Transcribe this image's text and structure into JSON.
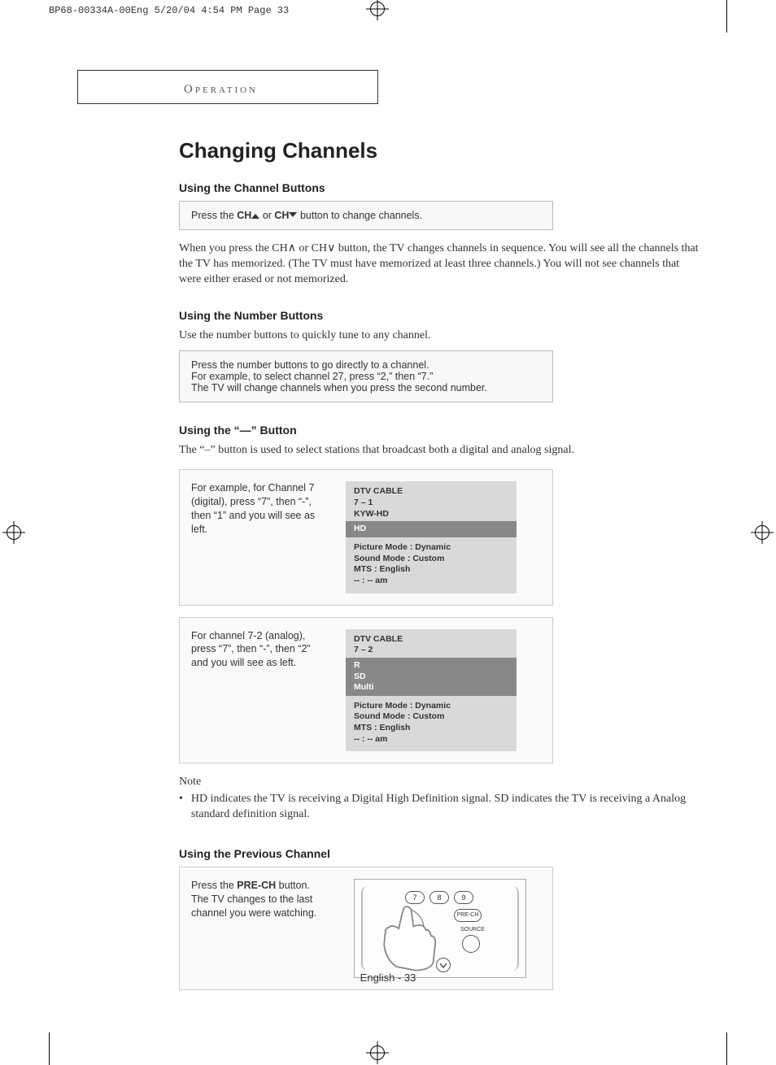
{
  "cropmark": "BP68-00334A-00Eng  5/20/04  4:54 PM  Page 33",
  "section_header": "Operation",
  "title": "Changing Channels",
  "s1": {
    "heading": "Using the Channel Buttons",
    "box_pre": "Press the ",
    "box_ch": "CH",
    "box_mid": "  or ",
    "box_post": " button to change channels.",
    "body": "When you press the CH∧  or CH∨ button, the TV changes channels in sequence. You will see all the channels that the TV has memorized. (The TV must have memorized at least three channels.) You will not see channels that were either erased or not memorized."
  },
  "s2": {
    "heading": "Using the Number Buttons",
    "lead": "Use the number buttons to quickly tune to any channel.",
    "box_l1": "Press the number buttons to go directly to a channel.",
    "box_l2": "For example, to select channel 27, press “2,” then “7.”",
    "box_l3": "The TV will change channels when you press the second number."
  },
  "s3": {
    "heading": "Using the “—” Button",
    "lead": "The “–” button is used to select stations that broadcast both a digital and analog signal.",
    "ex1_text": "For example, for Channel 7 (digital), press “7”, then “-”, then “1” and you will see as left.",
    "ex1_osd": {
      "l1": "DTV CABLE",
      "l2": "7 – 1",
      "l3": "KYW-HD",
      "band": "HD",
      "b1": "Picture Mode : Dynamic",
      "b2": "Sound Mode : Custom",
      "b3": "MTS : English",
      "b4": "-- : -- am"
    },
    "ex2_text": "For channel 7-2 (analog), press “7”, then “-”, then “2” and you will see as left.",
    "ex2_osd": {
      "l1": "DTV CABLE",
      "l2": "7 – 2",
      "band1": "R",
      "band2": "SD",
      "band3": "Multi",
      "b1": "Picture Mode : Dynamic",
      "b2": "Sound Mode : Custom",
      "b3": "MTS : English",
      "b4": "-- : -- am"
    }
  },
  "note": {
    "title": "Note",
    "bullet": "•",
    "text": "HD indicates the TV is receiving a Digital High Definition signal. SD indicates the TV is receiving a Analog standard definition signal."
  },
  "s4": {
    "heading": "Using the Previous Channel",
    "box_pre": "Press the ",
    "box_b": "PRE-CH",
    "box_post1": " button.",
    "box_l2": "The TV changes to the last channel you were watching.",
    "remote": {
      "b7": "7",
      "b8": "8",
      "b9": "9",
      "prech": "PRE-CH",
      "source": "SOURCE"
    }
  },
  "footer": "English - 33"
}
